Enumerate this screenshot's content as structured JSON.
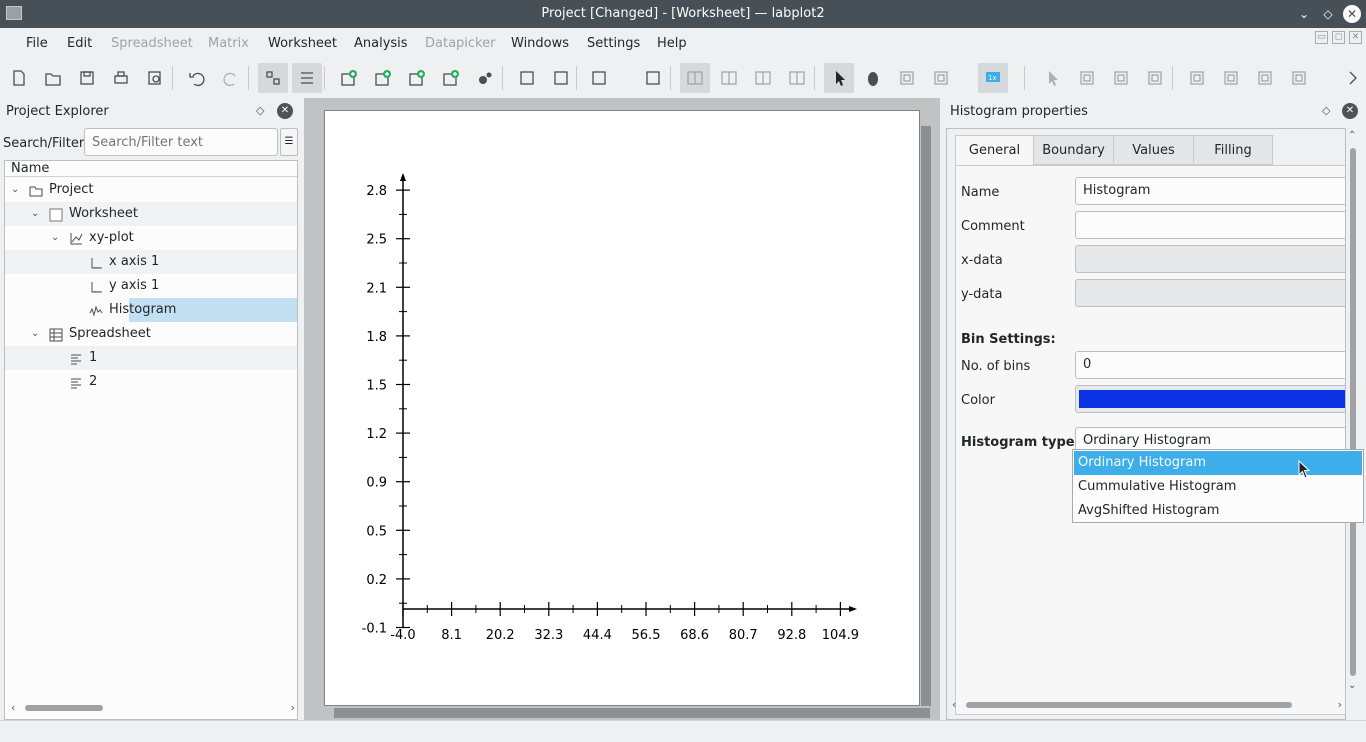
{
  "titlebar": {
    "title": "Project    [Changed] - [Worksheet] — labplot2"
  },
  "menubar": {
    "items": [
      {
        "label": "File",
        "enabled": true
      },
      {
        "label": "Edit",
        "enabled": true
      },
      {
        "label": "Spreadsheet",
        "enabled": false
      },
      {
        "label": "Matrix",
        "enabled": false
      },
      {
        "label": "Worksheet",
        "enabled": true
      },
      {
        "label": "Analysis",
        "enabled": true
      },
      {
        "label": "Datapicker",
        "enabled": false
      },
      {
        "label": "Windows",
        "enabled": true
      },
      {
        "label": "Settings",
        "enabled": true
      },
      {
        "label": "Help",
        "enabled": true
      }
    ]
  },
  "toolbar": {
    "icons": [
      "new-project-icon",
      "open-icon",
      "save-icon",
      "print-icon",
      "print-preview-icon",
      "undo-icon",
      "redo-icon",
      "tree-view-icon",
      "details-view-icon",
      "new-worksheet-icon",
      "new-spreadsheet-icon",
      "new-matrix-icon",
      "new-workbook-icon",
      "new-datapicker-icon",
      "import-icon",
      "export-icon",
      "add-plot-icon",
      "add-text-label-icon",
      "vertical-layout-icon",
      "horizontal-layout-icon",
      "grid-layout-icon",
      "break-layout-icon",
      "select-mode-icon",
      "navigate-mode-icon",
      "zoom-fit-icon",
      "zoom-select-icon",
      "zoom-1x-icon",
      "cursor-icon",
      "scale-auto-icon",
      "scale-auto-x-icon",
      "scale-auto-y-icon",
      "shift-left-icon",
      "shift-right-icon",
      "shift-up-icon",
      "shift-down-icon",
      "more-icon"
    ]
  },
  "explorer": {
    "title": "Project Explorer",
    "search_label": "Search/Filter:",
    "search_placeholder": "Search/Filter text",
    "column_header": "Name",
    "tree": [
      {
        "label": "Project",
        "icon": "project-icon",
        "level": 0,
        "expanded": true,
        "selected": false
      },
      {
        "label": "Worksheet",
        "icon": "worksheet-icon",
        "level": 1,
        "expanded": true,
        "selected": false
      },
      {
        "label": "xy-plot",
        "icon": "xy-plot-icon",
        "level": 2,
        "expanded": true,
        "selected": false
      },
      {
        "label": "x axis 1",
        "icon": "axis-icon",
        "level": 3,
        "selected": false
      },
      {
        "label": "y axis 1",
        "icon": "axis-icon",
        "level": 3,
        "selected": false
      },
      {
        "label": "Histogram",
        "icon": "histogram-icon",
        "level": 3,
        "selected": true
      },
      {
        "label": "Spreadsheet",
        "icon": "spreadsheet-icon",
        "level": 1,
        "expanded": true,
        "selected": false
      },
      {
        "label": "1",
        "icon": "column-icon",
        "level": 2,
        "selected": false
      },
      {
        "label": "2",
        "icon": "column-icon",
        "level": 2,
        "selected": false
      }
    ]
  },
  "chart_data": {
    "type": "line",
    "title": "",
    "xlabel": "",
    "ylabel": "",
    "series": [],
    "x_ticks": [
      "-4.0",
      "8.1",
      "20.2",
      "32.3",
      "44.4",
      "56.5",
      "68.6",
      "80.7",
      "92.8",
      "104.9"
    ],
    "y_ticks": [
      "-0.1",
      "0.2",
      "0.5",
      "0.9",
      "1.2",
      "1.5",
      "1.8",
      "2.1",
      "2.5",
      "2.8"
    ],
    "xlim": [
      -4.0,
      104.9
    ],
    "ylim": [
      -0.1,
      2.8
    ],
    "grid": false
  },
  "properties": {
    "title": "Histogram properties",
    "tabs": [
      {
        "label": "General",
        "active": true
      },
      {
        "label": "Boundary",
        "active": false
      },
      {
        "label": "Values",
        "active": false
      },
      {
        "label": "Filling",
        "active": false
      }
    ],
    "name_label": "Name",
    "name_value": "Histogram",
    "comment_label": "Comment",
    "comment_value": "",
    "xdata_label": "x-data",
    "xdata_value": "",
    "ydata_label": "y-data",
    "ydata_value": "",
    "bin_settings_label": "Bin Settings:",
    "bins_label": "No. of bins",
    "bins_value": "0",
    "color_label": "Color",
    "color_value": "#0b32e3",
    "hist_type_label": "Histogram type",
    "hist_type_value": "Ordinary Histogram",
    "hist_type_options": [
      "Ordinary Histogram",
      "Cummulative Histogram",
      "AvgShifted Histogram"
    ]
  }
}
